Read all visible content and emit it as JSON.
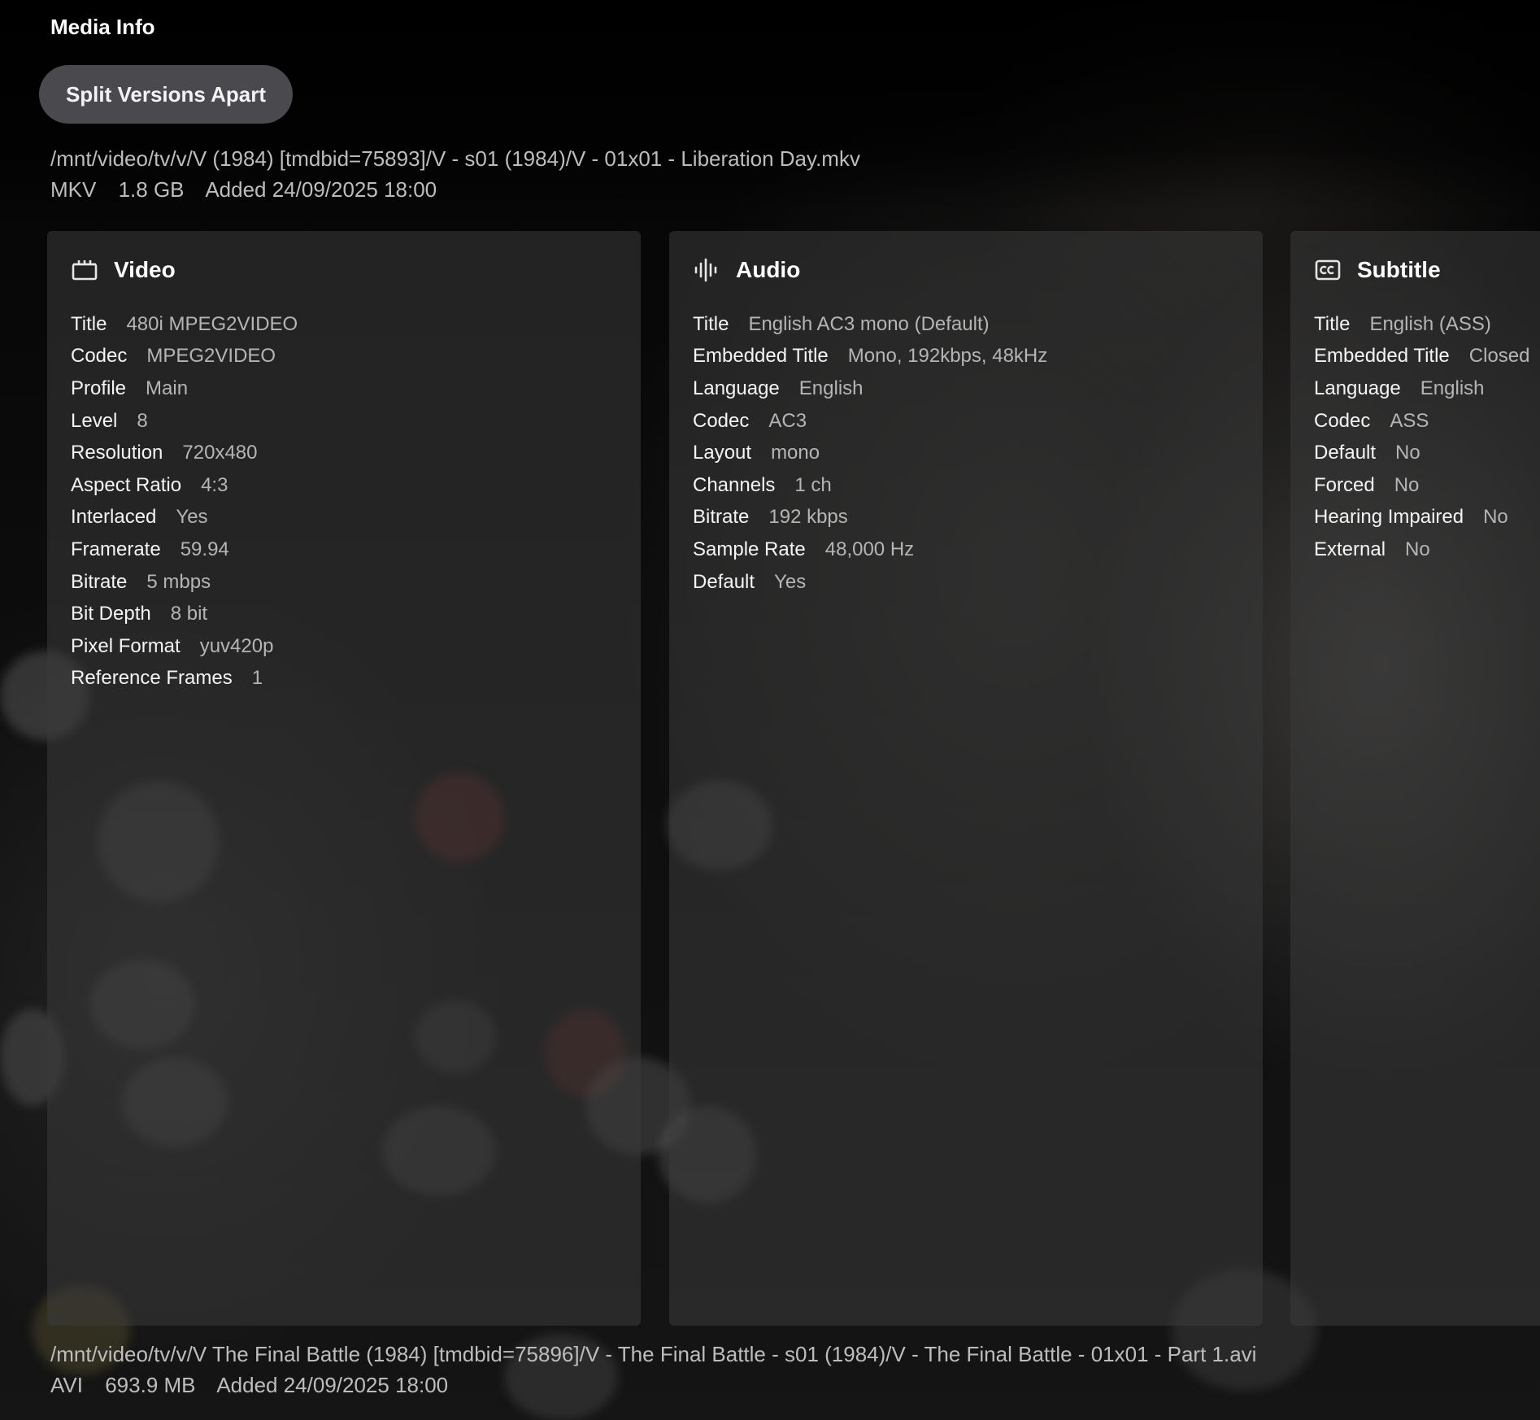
{
  "header": {
    "title": "Media Info",
    "split_button_label": "Split Versions Apart"
  },
  "versions": [
    {
      "path": "/mnt/video/tv/v/V (1984) [tmdbid=75893]/V - s01 (1984)/V - 01x01 - Liberation Day.mkv",
      "container": "MKV",
      "size": "1.8 GB",
      "added": "Added 24/09/2025 18:00"
    },
    {
      "path": "/mnt/video/tv/v/V The Final Battle (1984) [tmdbid=75896]/V - The Final Battle - s01 (1984)/V - The Final Battle - 01x01 - Part 1.avi",
      "container": "AVI",
      "size": "693.9 MB",
      "added": "Added 24/09/2025 18:00"
    }
  ],
  "streams": {
    "video": {
      "heading": "Video",
      "icon": "clapperboard-icon",
      "rows": [
        {
          "label": "Title",
          "value": "480i MPEG2VIDEO"
        },
        {
          "label": "Codec",
          "value": "MPEG2VIDEO"
        },
        {
          "label": "Profile",
          "value": "Main"
        },
        {
          "label": "Level",
          "value": "8"
        },
        {
          "label": "Resolution",
          "value": "720x480"
        },
        {
          "label": "Aspect Ratio",
          "value": "4:3"
        },
        {
          "label": "Interlaced",
          "value": "Yes"
        },
        {
          "label": "Framerate",
          "value": "59.94"
        },
        {
          "label": "Bitrate",
          "value": "5 mbps"
        },
        {
          "label": "Bit Depth",
          "value": "8 bit"
        },
        {
          "label": "Pixel Format",
          "value": "yuv420p"
        },
        {
          "label": "Reference Frames",
          "value": "1"
        }
      ]
    },
    "audio": {
      "heading": "Audio",
      "icon": "waveform-icon",
      "rows": [
        {
          "label": "Title",
          "value": "English AC3 mono (Default)"
        },
        {
          "label": "Embedded Title",
          "value": "Mono, 192kbps, 48kHz"
        },
        {
          "label": "Language",
          "value": "English"
        },
        {
          "label": "Codec",
          "value": "AC3"
        },
        {
          "label": "Layout",
          "value": "mono"
        },
        {
          "label": "Channels",
          "value": "1 ch"
        },
        {
          "label": "Bitrate",
          "value": "192 kbps"
        },
        {
          "label": "Sample Rate",
          "value": "48,000 Hz"
        },
        {
          "label": "Default",
          "value": "Yes"
        }
      ]
    },
    "subtitle": {
      "heading": "Subtitle",
      "icon": "closed-captions-icon",
      "rows": [
        {
          "label": "Title",
          "value": "English (ASS)"
        },
        {
          "label": "Embedded Title",
          "value": "Closed"
        },
        {
          "label": "Language",
          "value": "English"
        },
        {
          "label": "Codec",
          "value": "ASS"
        },
        {
          "label": "Default",
          "value": "No"
        },
        {
          "label": "Forced",
          "value": "No"
        },
        {
          "label": "Hearing Impaired",
          "value": "No"
        },
        {
          "label": "External",
          "value": "No"
        }
      ]
    }
  }
}
